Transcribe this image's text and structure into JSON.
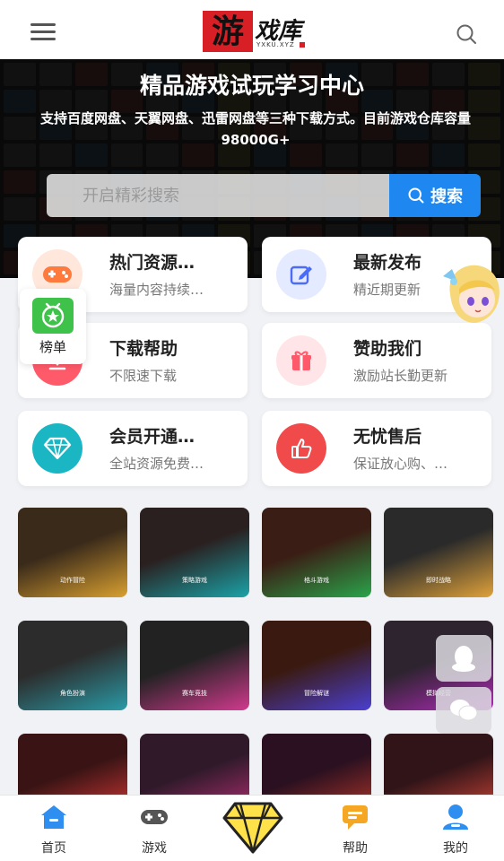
{
  "header": {
    "logo_char": "游",
    "logo_text": "戏库",
    "logo_sub": "YXKU.XYZ"
  },
  "banner": {
    "title": "精品游戏试玩学习中心",
    "description": "支持百度网盘、天翼网盘、迅雷网盘等三种下载方式。目前游戏仓库容量98000G+",
    "search_placeholder": "开启精彩搜索",
    "search_button": "搜索"
  },
  "cards": [
    {
      "title": "热门资源…",
      "subtitle": "海量内容持续…",
      "icon": "gamepad-icon",
      "color": "#ff7a3d"
    },
    {
      "title": "最新发布",
      "subtitle": "精近期更新",
      "icon": "edit-icon",
      "color": "#4a6cf7"
    },
    {
      "title": "下载帮助",
      "subtitle": "不限速下载",
      "icon": "download-icon",
      "color": "#ff5a6a"
    },
    {
      "title": "赞助我们",
      "subtitle": "激励站长勤更新",
      "icon": "gift-icon",
      "color": "#ff5a6a"
    },
    {
      "title": "会员开通…",
      "subtitle": "全站资源免费…",
      "icon": "diamond-icon",
      "color": "#1ab6c4"
    },
    {
      "title": "无忧售后",
      "subtitle": "保证放心购、…",
      "icon": "thumbs-up-icon",
      "color": "#f04a4a"
    }
  ],
  "rank_badge": {
    "label": "榜单"
  },
  "game_tiles": [
    {
      "label": "动作冒险"
    },
    {
      "label": "策略游戏"
    },
    {
      "label": "格斗游戏"
    },
    {
      "label": "即时战略"
    },
    {
      "label": "角色扮演"
    },
    {
      "label": "赛车竞技"
    },
    {
      "label": "冒险解谜"
    },
    {
      "label": "模拟经营"
    },
    {
      "label": ""
    },
    {
      "label": ""
    },
    {
      "label": ""
    },
    {
      "label": ""
    }
  ],
  "bottom_nav": [
    {
      "label": "首页",
      "icon": "home-icon",
      "color": "#2e8ff0"
    },
    {
      "label": "游戏",
      "icon": "gamepad-icon",
      "color": "#555"
    },
    {
      "label": "帮助",
      "icon": "help-chat-icon",
      "color": "#f5a623"
    },
    {
      "label": "我的",
      "icon": "user-icon",
      "color": "#2e8ff0"
    }
  ],
  "colors": {
    "accent": "#1e88f0",
    "logo_red": "#d81f26",
    "background": "#f1f2f6"
  }
}
